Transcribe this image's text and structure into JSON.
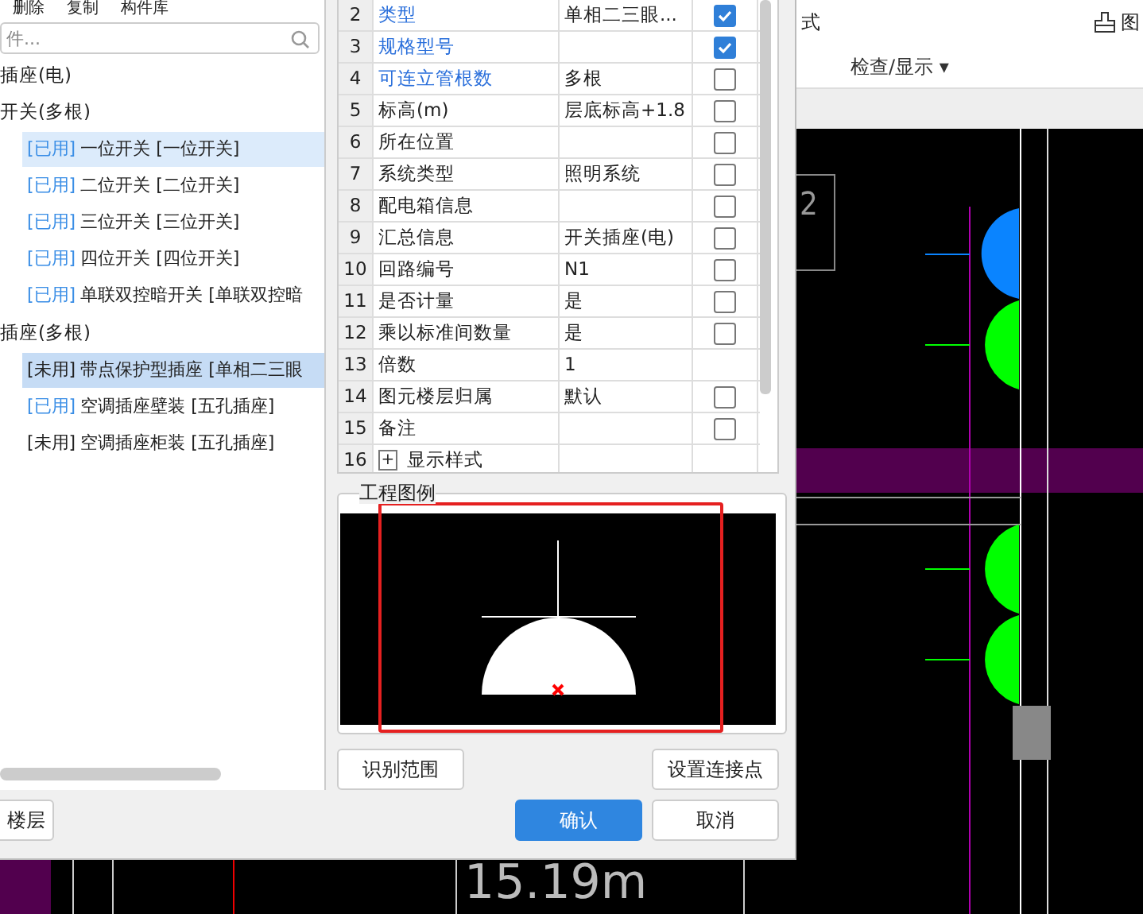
{
  "toolbar": [
    "删除",
    "复制",
    "构件库"
  ],
  "search": {
    "placeholder": "件..."
  },
  "tree": [
    {
      "label": "插座(电)"
    },
    {
      "label": "开关(多根)",
      "children": [
        {
          "tag": "[已用]",
          "used": true,
          "label": "一位开关 [一位开关]",
          "selected": false,
          "hovered": true
        },
        {
          "tag": "[已用]",
          "used": true,
          "label": "二位开关 [二位开关]",
          "selected": false,
          "hovered": false
        },
        {
          "tag": "[已用]",
          "used": true,
          "label": "三位开关 [三位开关]",
          "selected": false,
          "hovered": false
        },
        {
          "tag": "[已用]",
          "used": true,
          "label": "四位开关 [四位开关]",
          "selected": false,
          "hovered": false
        },
        {
          "tag": "[已用]",
          "used": true,
          "label": "单联双控暗开关 [单联双控暗",
          "selected": false,
          "hovered": false
        }
      ]
    },
    {
      "label": "插座(多根)",
      "children": [
        {
          "tag": "[未用]",
          "used": false,
          "label": "带点保护型插座 [单相二三眼",
          "selected": true,
          "hovered": false
        },
        {
          "tag": "[已用]",
          "used": true,
          "label": "空调插座壁装 [五孔插座]",
          "selected": false,
          "hovered": false
        },
        {
          "tag": "[未用]",
          "used": false,
          "label": "空调插座柜装 [五孔插座]",
          "selected": false,
          "hovered": false
        }
      ]
    }
  ],
  "properties": [
    {
      "kind": "check",
      "num": "2",
      "name": "类型",
      "public": true,
      "value": "单相二三眼...",
      "checked": true
    },
    {
      "kind": "check",
      "num": "3",
      "name": "规格型号",
      "public": true,
      "checked": true
    },
    {
      "kind": "check",
      "num": "4",
      "name": "可连立管根数",
      "public": true,
      "value": "多根",
      "checked": false
    },
    {
      "kind": "check",
      "num": "5",
      "name": "标高(m)",
      "public": false,
      "value": "层底标高+1.8",
      "checked": false
    },
    {
      "kind": "check",
      "num": "6",
      "name": "所在位置",
      "public": false,
      "checked": false
    },
    {
      "kind": "check",
      "num": "7",
      "name": "系统类型",
      "public": false,
      "value": "照明系统",
      "checked": false
    },
    {
      "kind": "check",
      "num": "8",
      "name": "配电箱信息",
      "public": false,
      "checked": false
    },
    {
      "kind": "check",
      "num": "9",
      "name": "汇总信息",
      "public": false,
      "value": "开关插座(电)",
      "checked": false
    },
    {
      "kind": "check",
      "num": "10",
      "name": "回路编号",
      "public": false,
      "value": "N1",
      "checked": false
    },
    {
      "kind": "check",
      "num": "11",
      "name": "是否计量",
      "public": false,
      "value": "是",
      "checked": false
    },
    {
      "kind": "check",
      "num": "12",
      "name": "乘以标准间数量",
      "public": false,
      "value": "是",
      "checked": false
    },
    {
      "kind": "plain",
      "num": "13",
      "name": "倍数",
      "public": false,
      "value": "1"
    },
    {
      "kind": "check",
      "num": "14",
      "name": "图元楼层归属",
      "public": false,
      "value": "默认",
      "checked": false
    },
    {
      "kind": "check",
      "num": "15",
      "name": "备注",
      "public": false,
      "checked": false
    },
    {
      "kind": "group",
      "num": "16",
      "expand_sign": "+",
      "name": "显示样式",
      "expanded": false
    }
  ],
  "legend": {
    "title": "工程图例"
  },
  "legend_buttons": [
    "识别范围",
    "设置连接点"
  ],
  "footer": {
    "floor_button": "楼层",
    "ok": "确认",
    "cancel": "取消"
  },
  "ribbon": {
    "formula": "式",
    "check_menu": "检查/显示",
    "caret": "▾",
    "right_cut": "图"
  },
  "canvas": {
    "frame_label": "2",
    "dimension": "15.19m"
  }
}
